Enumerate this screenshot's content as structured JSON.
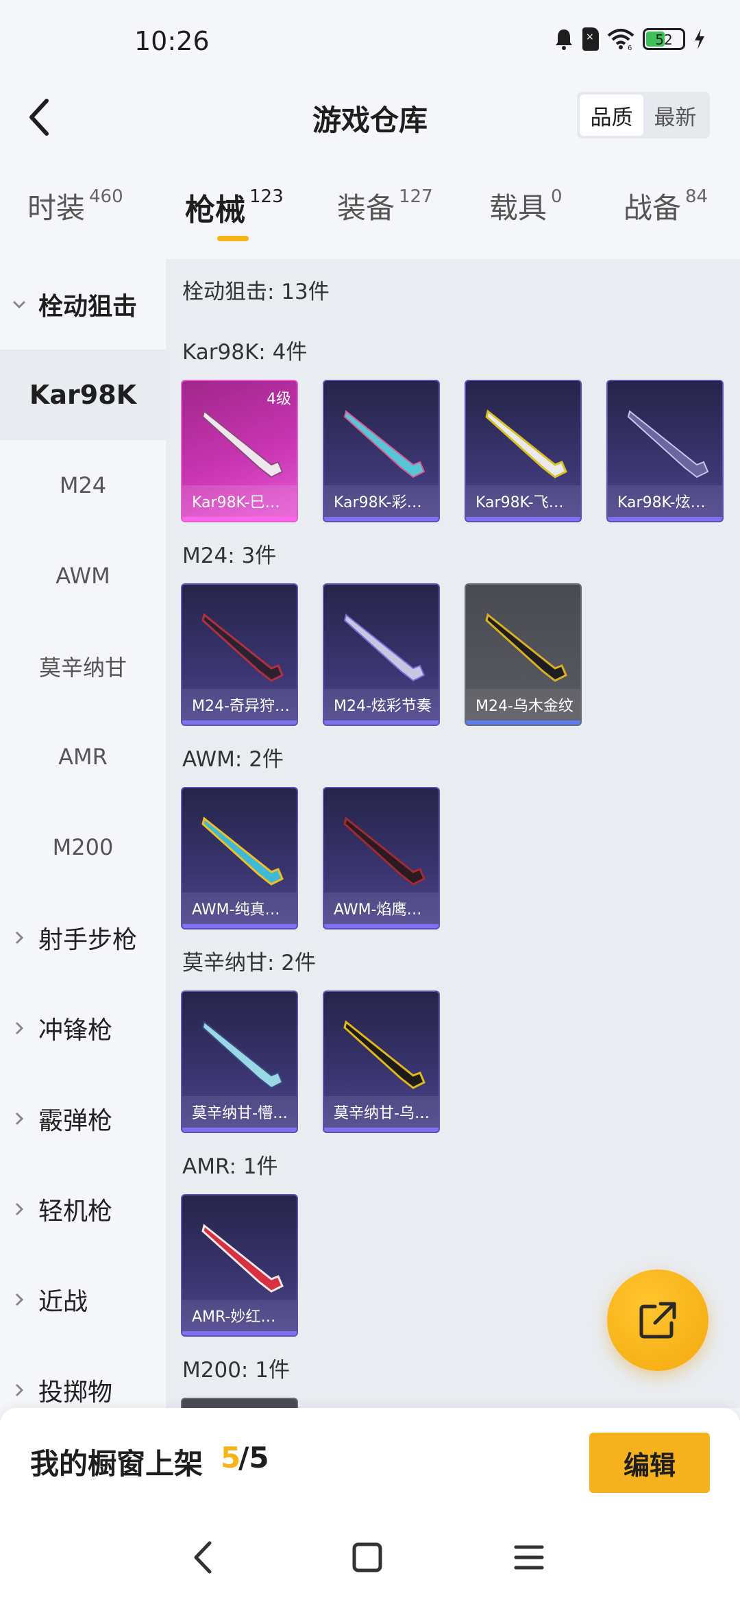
{
  "status": {
    "time": "10:26",
    "battery": "52",
    "battery_level": 0.52,
    "wifi_badge": "6"
  },
  "header": {
    "title": "游戏仓库",
    "sort_quality": "品质",
    "sort_newest": "最新"
  },
  "tabs": [
    {
      "label": "时装",
      "count": "460"
    },
    {
      "label": "枪械",
      "count": "123"
    },
    {
      "label": "装备",
      "count": "127"
    },
    {
      "label": "载具",
      "count": "0"
    },
    {
      "label": "战备",
      "count": "84"
    }
  ],
  "sidebar": {
    "group": "栓动狙击",
    "items": [
      "Kar98K",
      "M24",
      "AWM",
      "莫辛纳甘",
      "AMR",
      "M200"
    ],
    "groups": [
      "射手步枪",
      "冲锋枪",
      "霰弹枪",
      "轻机枪",
      "近战",
      "投掷物"
    ]
  },
  "content": {
    "summary": "栓动狙击: 13件",
    "sections": [
      {
        "title": "Kar98K: 4件",
        "cards": [
          {
            "name": "Kar98K-巳…",
            "level": "4级"
          },
          {
            "name": "Kar98K-彩…"
          },
          {
            "name": "Kar98K-飞…"
          },
          {
            "name": "Kar98K-炫…"
          }
        ]
      },
      {
        "title": "M24: 3件",
        "cards": [
          {
            "name": "M24-奇异狩…"
          },
          {
            "name": "M24-炫彩节奏"
          },
          {
            "name": "M24-乌木金纹"
          }
        ]
      },
      {
        "title": "AWM: 2件",
        "cards": [
          {
            "name": "AWM-纯真…"
          },
          {
            "name": "AWM-焰鹰…"
          }
        ]
      },
      {
        "title": "莫辛纳甘: 2件",
        "cards": [
          {
            "name": "莫辛纳甘-懵…"
          },
          {
            "name": "莫辛纳甘-乌…"
          }
        ]
      },
      {
        "title": "AMR: 1件",
        "cards": [
          {
            "name": "AMR-妙红…"
          }
        ]
      },
      {
        "title": "M200: 1件",
        "cards": []
      }
    ]
  },
  "bottom": {
    "shelf_label": "我的橱窗上架",
    "shelf_used": "5",
    "shelf_total": "/5",
    "edit_label": "编辑"
  },
  "colors": {
    "accent": "#f5b418",
    "card_purple": "#3a3570",
    "card_legend": "#c935b3",
    "card_gray": "#55565d"
  }
}
